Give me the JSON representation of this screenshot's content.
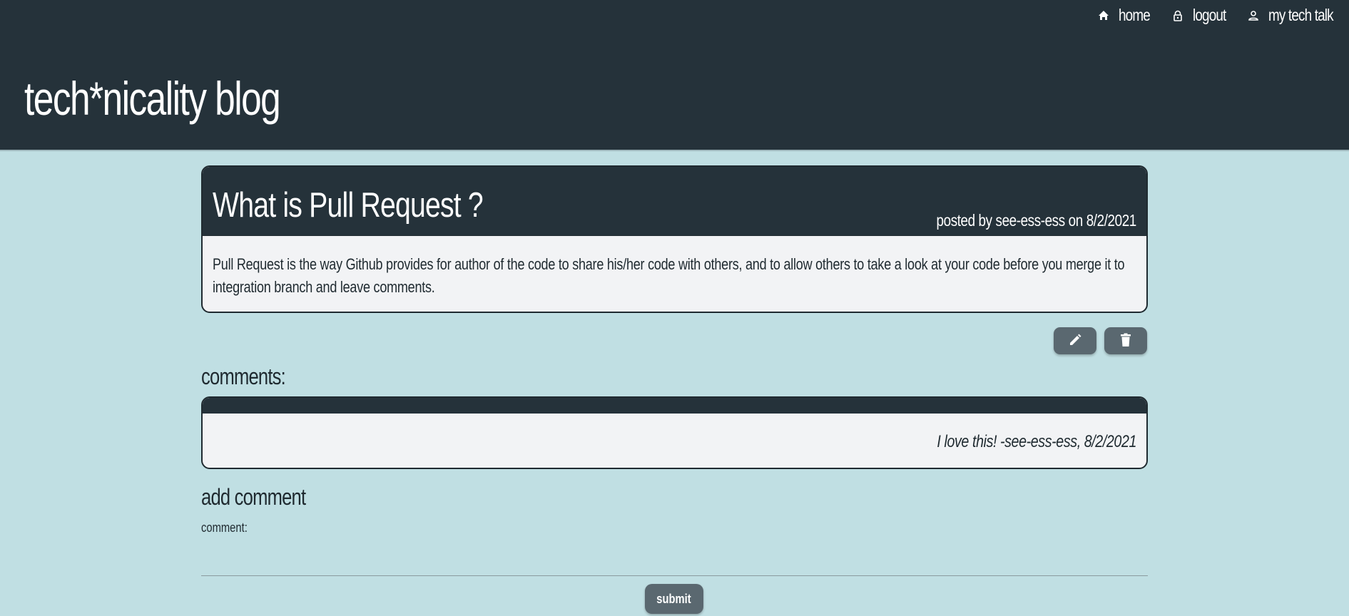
{
  "nav": {
    "home_label": "home",
    "logout_label": "logout",
    "dashboard_label": "my tech talk"
  },
  "site": {
    "title": "tech*nicality blog"
  },
  "post": {
    "title": "What is Pull Request ?",
    "meta_prefix": "posted by",
    "author": "see-ess-ess",
    "meta_on": "on",
    "date": "8/2/2021",
    "body": "Pull Request is the way Github provides for author of the code to share his/her code with others, and to allow others to take a look at your code before you merge it to integration branch and leave comments."
  },
  "actions": {
    "edit_icon": "pencil-icon",
    "delete_icon": "trash-icon"
  },
  "comments": {
    "heading": "comments:",
    "items": [
      {
        "text": "I love this!",
        "author": "-see-ess-ess,",
        "date": "8/2/2021"
      }
    ]
  },
  "add_comment": {
    "heading": "add comment",
    "label": "comment:",
    "value": "",
    "submit_label": "submit"
  },
  "colors": {
    "header_bg": "#25323a",
    "page_bg": "#c0dfe3",
    "card_bg": "#f2f3f5",
    "button_bg": "#5a6870"
  }
}
